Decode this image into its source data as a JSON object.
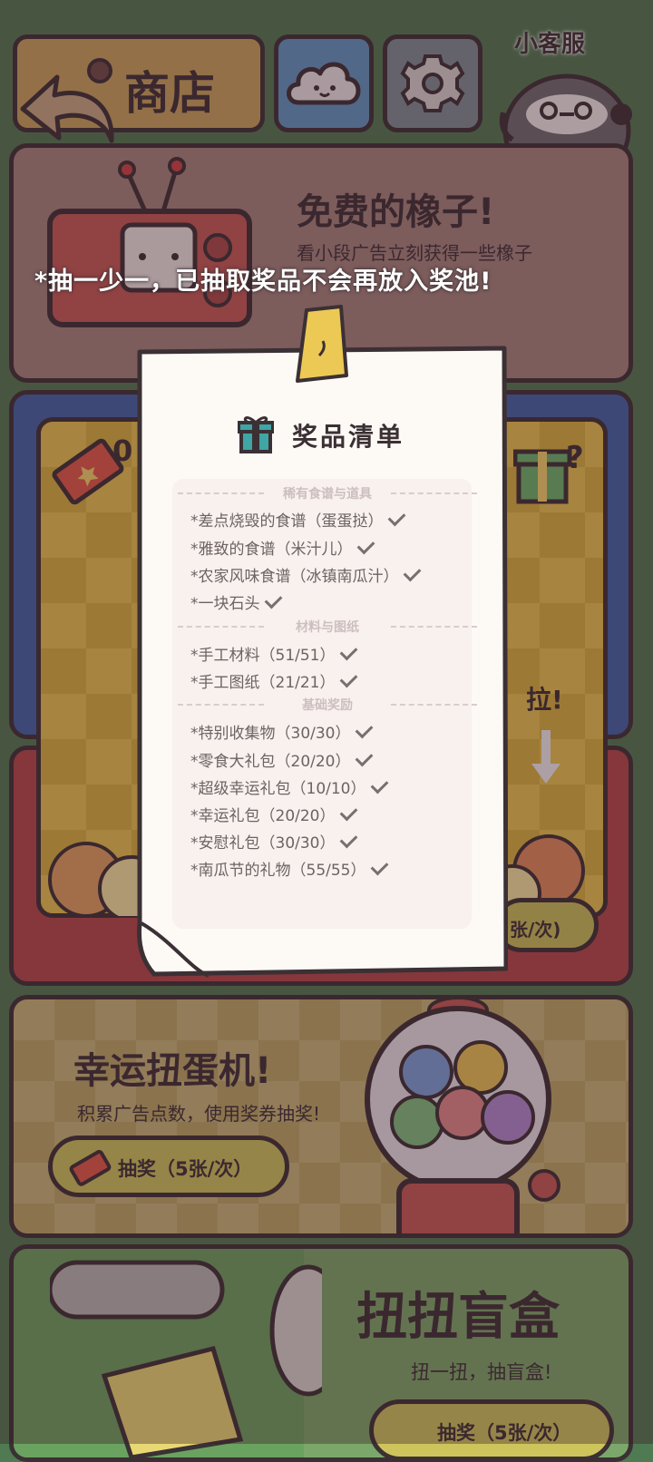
{
  "top_bar": {
    "shop_label": "商店",
    "service_label": "小客服"
  },
  "ad_panel": {
    "title": "免费的橡子!",
    "subtitle": "看小段广告立刻获得一些橡子"
  },
  "banner_notice": "*抽一少一，已抽取奖品不会再放入奖池!",
  "prize_machine": {
    "ticket_count": "0",
    "pull_label": "拉!",
    "cost_partial": "张/次)"
  },
  "gacha_panel": {
    "title": "幸运扭蛋机!",
    "subtitle": "积累广告点数，使用奖券抽奖!",
    "button_label": "抽奖（5张/次）"
  },
  "blindbox_panel": {
    "title": "扭扭盲盒",
    "subtitle": "扭一扭，抽盲盒!",
    "button_label": "抽奖（5张/次）"
  },
  "prize_list": {
    "title": "奖品清单",
    "sections": [
      {
        "header": "稀有食谱与道具",
        "items": [
          "*差点烧毁的食谱（蛋蛋挞）",
          "*雅致的食谱（米汁儿）",
          "*农家风味食谱（冰镇南瓜汁）",
          "*一块石头"
        ]
      },
      {
        "header": "材料与图纸",
        "items": [
          "*手工材料（51/51）",
          "*手工图纸（21/21）"
        ]
      },
      {
        "header": "基础奖励",
        "items": [
          "*特别收集物（30/30）",
          "*零食大礼包（20/20）",
          "*超级幸运礼包（10/10）",
          "*幸运礼包（20/20）",
          "*安慰礼包（30/30）",
          "*南瓜节的礼物（55/55）"
        ]
      }
    ]
  },
  "colors": {
    "background": "#4f7a52",
    "outline": "#3b3034",
    "ad_panel": "#a5847c",
    "gacha_panel": "#c8b678",
    "paper": "#fdfaf6"
  }
}
